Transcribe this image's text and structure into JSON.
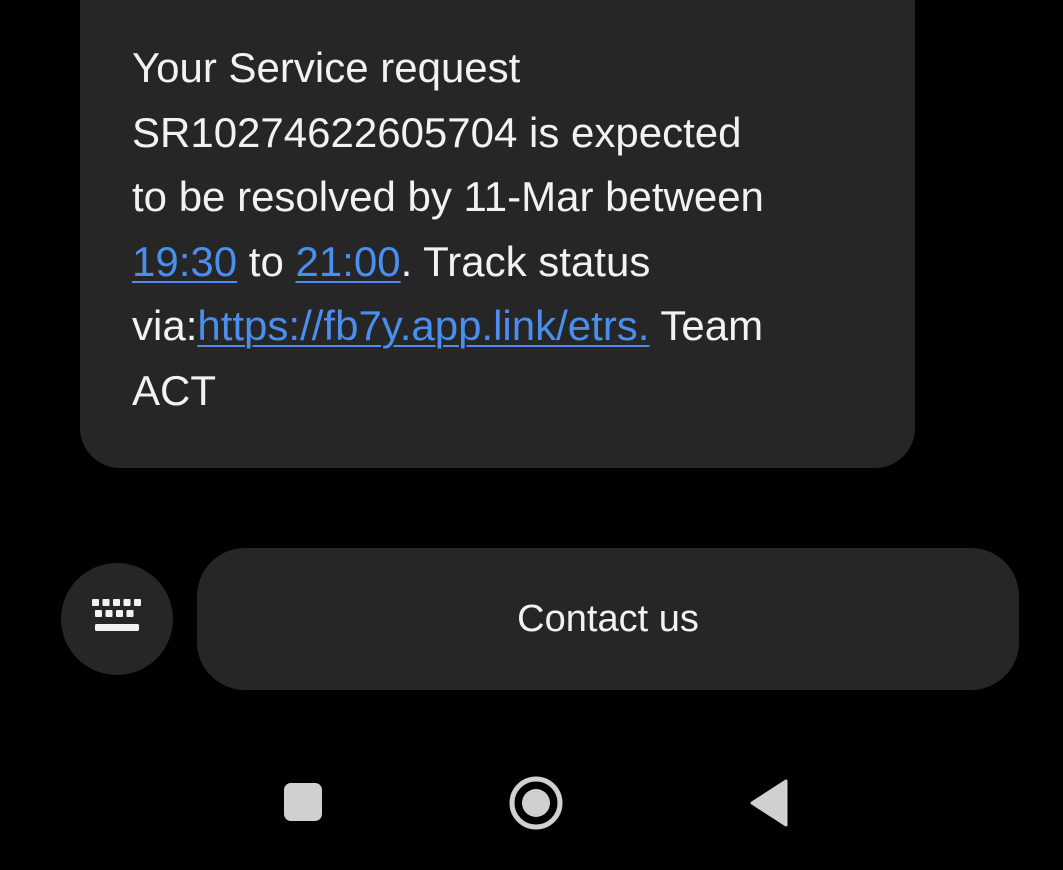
{
  "message": {
    "line1": "Your Service request",
    "line2": "SR10274622605704 is expected",
    "line3": "to be resolved by 11-Mar between",
    "line4": {
      "time_start": "19:30",
      "middle": " to ",
      "time_end": "21:00",
      "suffix": ". Track status"
    },
    "line5": {
      "prefix": "via:",
      "link": "https://fb7y.app.link/etrs.",
      "suffix": " Team"
    },
    "line6": "ACT"
  },
  "reply": {
    "keyboard_icon": "keyboard-icon",
    "suggestion": "Contact us"
  },
  "navigation": {
    "recents_icon": "recents-square-icon",
    "home_icon": "home-circle-icon",
    "back_icon": "back-triangle-icon"
  },
  "colors": {
    "background": "#000000",
    "bubble": "#262626",
    "text": "#f2f2f2",
    "link": "#4a8ff0",
    "nav_icon": "#d0d0d0"
  }
}
